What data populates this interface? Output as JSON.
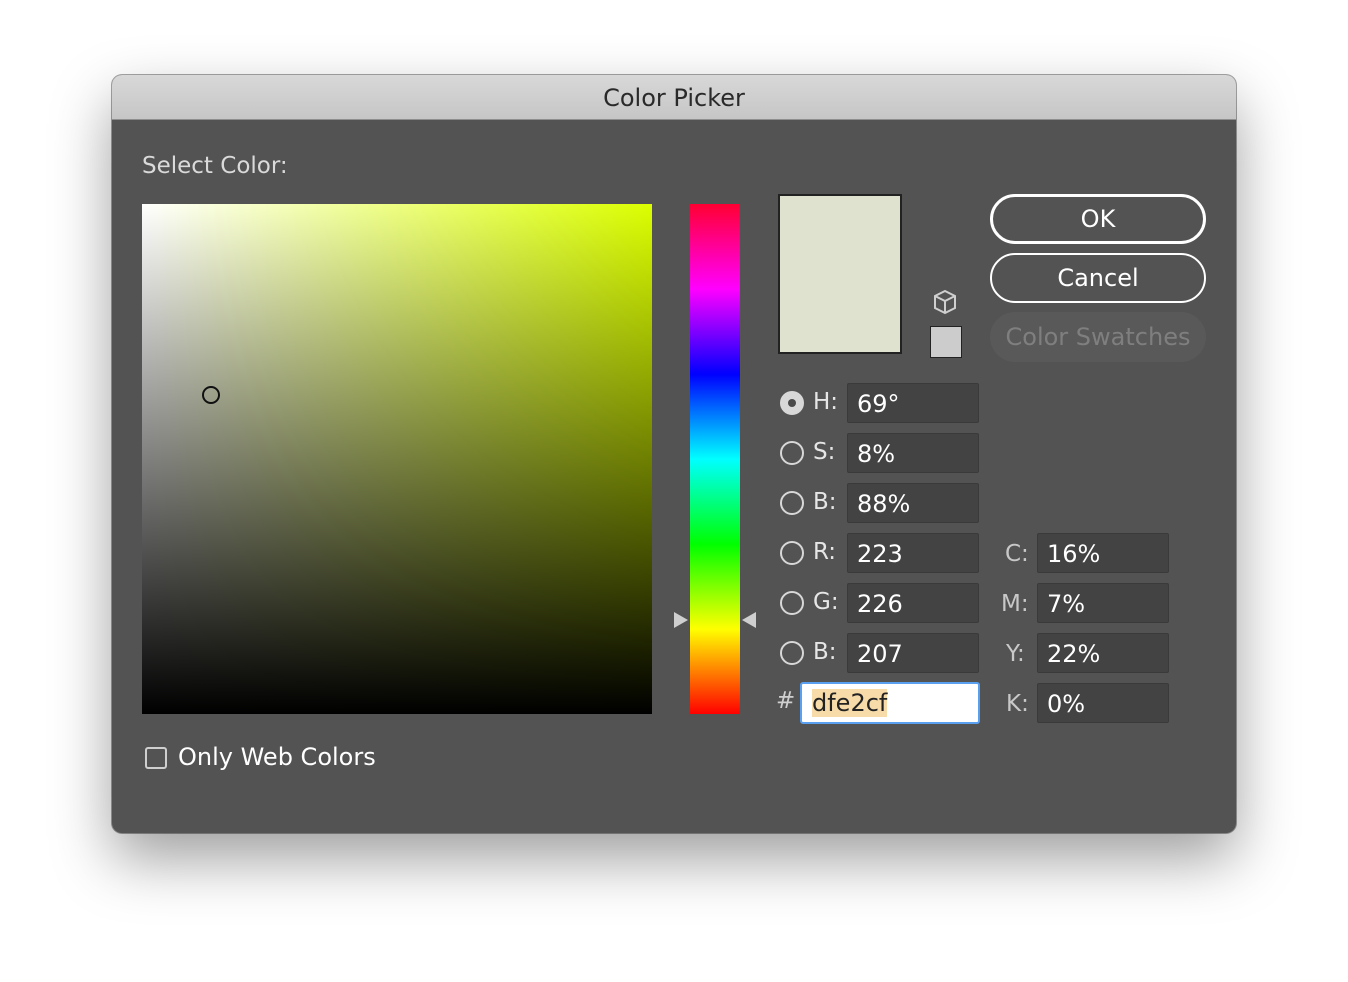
{
  "window": {
    "title": "Color Picker"
  },
  "picker": {
    "select_label": "Select Color:",
    "current_color": "#dfe2cf",
    "hue_base_color": "#dcff00"
  },
  "buttons": {
    "ok": "OK",
    "cancel": "Cancel",
    "swatches": "Color Swatches"
  },
  "hsb": {
    "h_label": "H:",
    "h_value": "69°",
    "s_label": "S:",
    "s_value": "8%",
    "b_label": "B:",
    "b_value": "88%"
  },
  "rgb": {
    "r_label": "R:",
    "r_value": "223",
    "g_label": "G:",
    "g_value": "226",
    "b_label": "B:",
    "b_value": "207"
  },
  "cmyk": {
    "c_label": "C:",
    "c_value": "16%",
    "m_label": "M:",
    "m_value": "7%",
    "y_label": "Y:",
    "y_value": "22%",
    "k_label": "K:",
    "k_value": "0%"
  },
  "hex": {
    "symbol": "#",
    "value": "dfe2cf"
  },
  "options": {
    "only_web_colors": "Only Web Colors",
    "only_web_colors_checked": false
  },
  "icons": {
    "cube": "web-safe-cube-icon",
    "swatch": "web-safe-swatch-icon"
  }
}
